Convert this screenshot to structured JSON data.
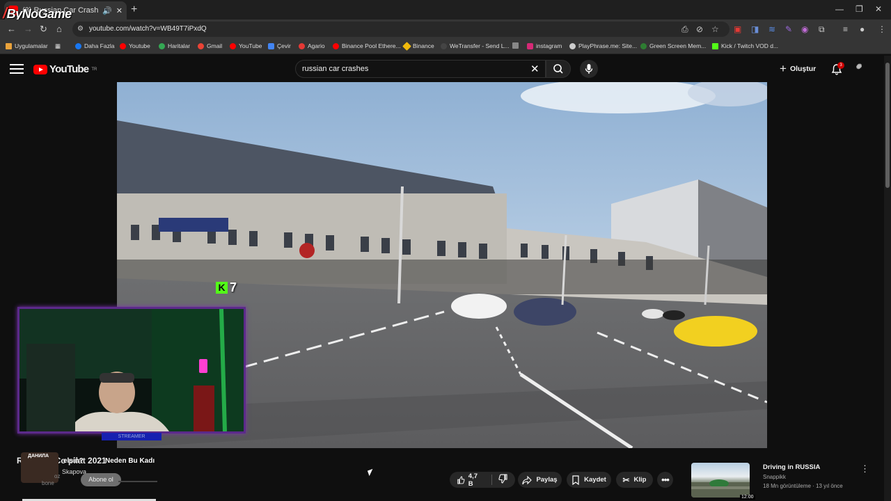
{
  "browser": {
    "tab_title": "(3) Russian Car Crash Comp",
    "watermark": "ByNoGame",
    "url": "youtube.com/watch?v=WB49T7iPxdQ",
    "bookmarks": [
      {
        "label": "Uygulamalar",
        "color": "#e9a23b"
      },
      {
        "label": "Daha Fazla",
        "color": "#1877f2"
      },
      {
        "label": "Youtube",
        "color": "#ff0000"
      },
      {
        "label": "Haritalar",
        "color": "#34a853"
      },
      {
        "label": "Gmail",
        "color": "#ea4335"
      },
      {
        "label": "YouTube",
        "color": "#ff0000"
      },
      {
        "label": "Çevir",
        "color": "#4285f4"
      },
      {
        "label": "Agario",
        "color": "#e53935"
      },
      {
        "label": "Binance Pool Ethere...",
        "color": "#ff0000"
      },
      {
        "label": "Binance",
        "color": "#f0b90b"
      },
      {
        "label": "WeTransfer - Send L...",
        "color": "#444444"
      },
      {
        "label": "",
        "color": "#888888"
      },
      {
        "label": "instagram",
        "color": "#d62976"
      },
      {
        "label": "PlayPhrase.me: Site...",
        "color": "#cccccc"
      },
      {
        "label": "Green Screen Mem...",
        "color": "#2e7d32"
      },
      {
        "label": "Kick / Twitch VOD d...",
        "color": "#53fc18"
      }
    ]
  },
  "youtube": {
    "logo_text": "YouTube",
    "logo_country": "TR",
    "search_query": "russian car crashes",
    "create_label": "Oluştur",
    "notification_count": "3"
  },
  "player": {
    "overlay_number": "7"
  },
  "stream": {
    "cam_tag": "STREAMER"
  },
  "video": {
    "title": "R   Ca   ash Co  pilat   2021",
    "caption_left": "elsin?",
    "caption_right": "Neden Bu Kadı",
    "channel_avatar_label": "ДАНИЛА",
    "channel_name": "Skapova",
    "sub_count_fragment": "oz",
    "sub_count_fragment2": "bone",
    "subscribe_label": "Abone ol",
    "like_count": "4,7 B",
    "share_label": "Paylaş",
    "save_label": "Kaydet",
    "clip_label": "Klip"
  },
  "recommendation": {
    "title": "Driving in RUSSIA",
    "channel": "Snappikk",
    "meta": "18 Mn görüntüleme · 13 yıl önce",
    "duration": "12:00"
  }
}
